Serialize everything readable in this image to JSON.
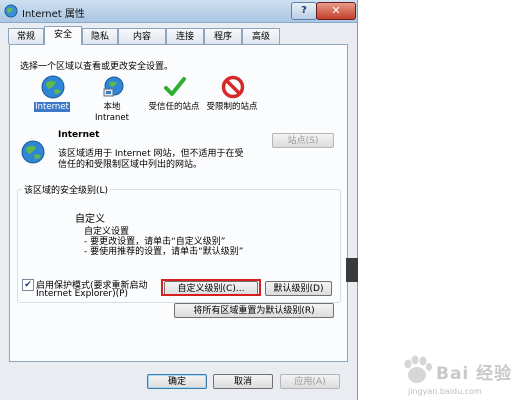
{
  "window": {
    "title": "Internet 属性",
    "help": "?",
    "close": "✕"
  },
  "tabs": [
    {
      "label": "常规"
    },
    {
      "label": "安全"
    },
    {
      "label": "隐私"
    },
    {
      "label": "内容"
    },
    {
      "label": "连接"
    },
    {
      "label": "程序"
    },
    {
      "label": "高级"
    }
  ],
  "security": {
    "instruction": "选择一个区域以查看或更改安全设置。",
    "zones": [
      {
        "name": "Internet",
        "icon": "globe-icon"
      },
      {
        "name": "本地\nIntranet",
        "icon": "intranet-icon"
      },
      {
        "name": "受信任的站点",
        "icon": "checkmark-icon"
      },
      {
        "name": "受限制的站点",
        "icon": "no-entry-icon"
      }
    ],
    "zone_title": "Internet",
    "zone_desc_line1": "该区域适用于 Internet 网站，但不适用于在受",
    "zone_desc_line2": "信任的和受限制区域中列出的网站。",
    "sites_button": "站点(S)",
    "level_group_label": "该区域的安全级别(L)",
    "custom_title": "自定义",
    "custom_line1": "自定义设置",
    "custom_line2": "- 要更改设置，请单击“自定义级别”",
    "custom_line3": "- 要使用推荐的设置，请单击“默认级别”",
    "protected_mode_line1": "启用保护模式(要求重新启动",
    "protected_mode_line2": "Internet Explorer)(P)",
    "protected_mode_checked": true,
    "custom_level_button": "自定义级别(C)...",
    "default_level_button": "默认级别(D)",
    "reset_all_button": "将所有区域重置为默认级别(R)"
  },
  "footer": {
    "ok": "确定",
    "cancel": "取消",
    "apply": "应用(A)"
  },
  "watermark": {
    "brand": "Bai 经验",
    "url": "jingyan.baidu.com"
  },
  "colors": {
    "highlight": "#d62020",
    "selection": "#3c78c8"
  }
}
